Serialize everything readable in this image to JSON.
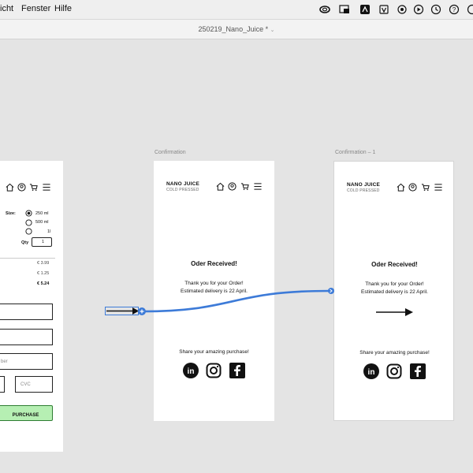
{
  "menubar": {
    "items": [
      "icht",
      "Fenster",
      "Hilfe"
    ],
    "icons": [
      "creative-cloud-icon",
      "screen-icon",
      "app-icon",
      "shield-icon",
      "tool-icon",
      "play-icon",
      "history-icon",
      "help-icon",
      "settings-icon"
    ]
  },
  "titlebar": {
    "title": "250219_Nano_Juice *"
  },
  "artboards": {
    "left": {
      "size_label": "Size:",
      "sizes": [
        "250 ml",
        "500 ml",
        "1l"
      ],
      "qty_label": "Qty",
      "qty_value": "1",
      "prices": [
        "€ 3.99",
        "€ 1.25",
        "€ 5.24"
      ],
      "card_placeholder": "ber",
      "cvc_placeholder": "CVC",
      "purchase_label": "PURCHASE"
    },
    "confirmation": {
      "name": "Confirmation",
      "brand": "NANO JUICE",
      "subbrand": "COLD PRESSED",
      "heading": "Oder Received!",
      "thanks": "Thank you for your Order!",
      "delivery": "Estimated delivery is 22 April.",
      "share": "Share your amazing purchase!"
    },
    "confirmation1": {
      "name": "Confirmation – 1",
      "brand": "NANO JUICE",
      "subbrand": "COLD PRESSED",
      "heading": "Oder Received!",
      "thanks": "Thank you for your Order!",
      "delivery": "Estimated delivery is 22 April.",
      "share": "Share your amazing purchase!"
    }
  },
  "colors": {
    "connector": "#3d7bd8",
    "purchase_bg": "#b6efb3",
    "purchase_border": "#2e7d32"
  }
}
